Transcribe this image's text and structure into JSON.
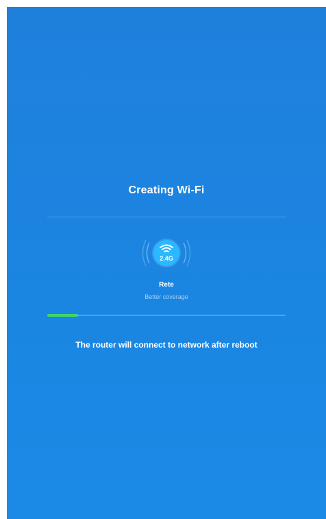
{
  "screen": {
    "title": "Creating Wi-Fi",
    "background_color": "#1f80dc"
  },
  "network": {
    "icon": "wifi-icon",
    "band_label": "2.4G",
    "name": "Rete",
    "subtitle": "Better coverage"
  },
  "progress": {
    "fraction": 0.13,
    "fill_color": "#3dd66a"
  },
  "message": "The router will connect to network after reboot"
}
